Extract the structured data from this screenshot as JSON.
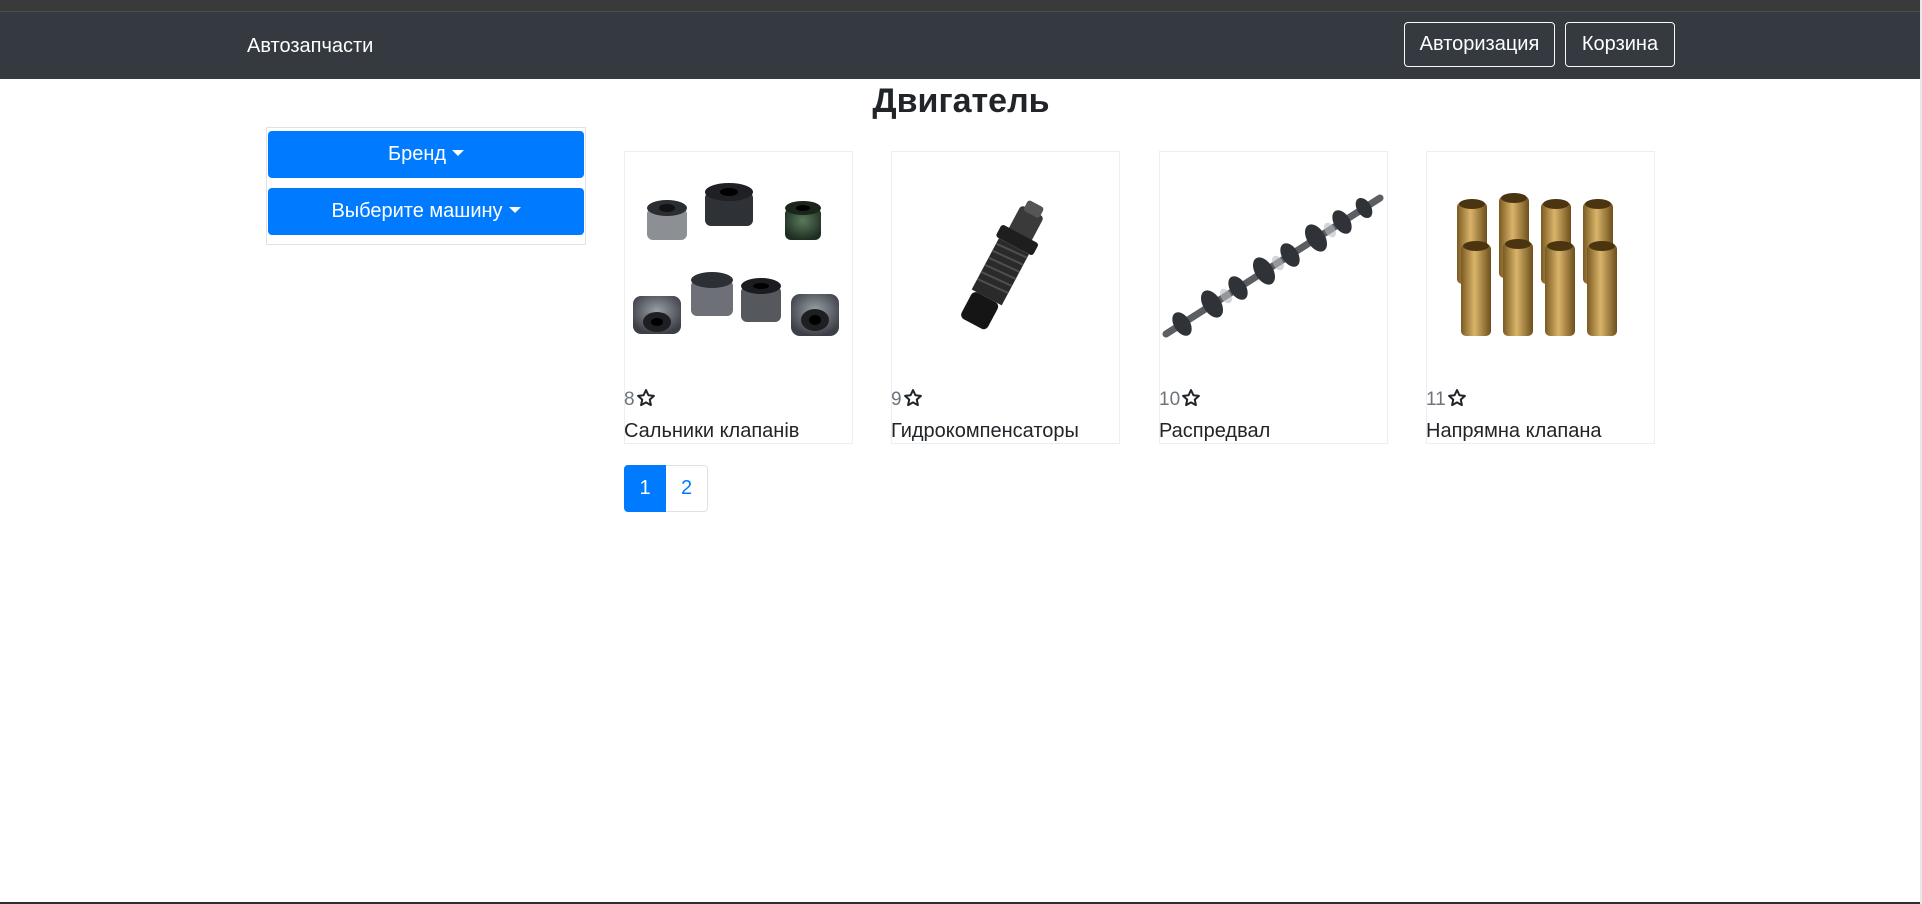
{
  "header": {
    "brand": "Автозапчасти",
    "auth_button": "Авторизация",
    "cart_button": "Корзина"
  },
  "page": {
    "title": "Двигатель"
  },
  "filters": {
    "brand_dropdown": "Бренд",
    "car_dropdown": "Выберите машину"
  },
  "products": [
    {
      "rating": "8",
      "name": "Сальники клапанів",
      "image": "valve-seals"
    },
    {
      "rating": "9",
      "name": "Гидрокомпенсаторы",
      "image": "hydraulic-lifter"
    },
    {
      "rating": "10",
      "name": "Распредвал",
      "image": "camshaft"
    },
    {
      "rating": "11",
      "name": "Напрямна клапана",
      "image": "valve-guides"
    }
  ],
  "pagination": {
    "pages": [
      "1",
      "2"
    ],
    "active": "1"
  },
  "colors": {
    "navbar": "#343a40",
    "primary": "#007bff"
  }
}
